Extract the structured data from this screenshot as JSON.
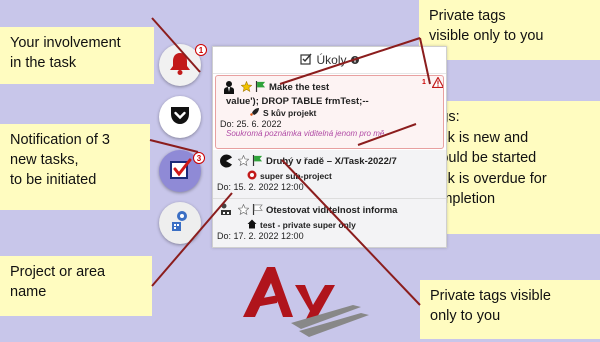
{
  "callouts": {
    "involvement": "Your involvement\nin the task",
    "notification": "Notification of 3\nnew tasks,\nto be initiated",
    "project": "Project or area\nname",
    "private_top": "Private tags\nvisible only to you",
    "tags": "Tags:\nTask is new and\nshould be started\nTask is overdue for\ncompletion",
    "private_bottom": "Private tags visible\nonly to you"
  },
  "sidebar": {
    "notification_count": "3",
    "involvement_count": "1"
  },
  "panel": {
    "title": "Úkoly",
    "tasks": [
      {
        "title": "Make the test",
        "title2": "value'); DROP TABLE frmTest;--",
        "project": "S kův projekt",
        "date": "Do: 25. 6. 2022",
        "note": "Soukromá poznámka viditelná jenom pro mě",
        "badge": "1"
      },
      {
        "title": "Druhý v řadě – X/Task-2022/7",
        "project": "super sub-project",
        "date": "Do: 15. 2. 2022 12:00"
      },
      {
        "title": "Otestovat viditelnost informa",
        "project": "test - private super only",
        "date": "Do: 17. 2. 2022 12:00"
      }
    ]
  },
  "colors": {
    "background": "#c8c6ea",
    "callout": "#fffcc0",
    "connector": "#8b1d1d",
    "logo_red": "#b0141c",
    "flag_green": "#2fa33a",
    "star_yellow": "#f2c200"
  },
  "icons": [
    "bell-icon",
    "pocket-icon",
    "checkbox-icon",
    "person-location-icon",
    "checklist-icon",
    "star-icon",
    "flag-icon",
    "alert-icon",
    "info-icon",
    "person-icon",
    "pacman-icon",
    "org-icon",
    "home-icon",
    "rocket-icon",
    "project-icon"
  ]
}
